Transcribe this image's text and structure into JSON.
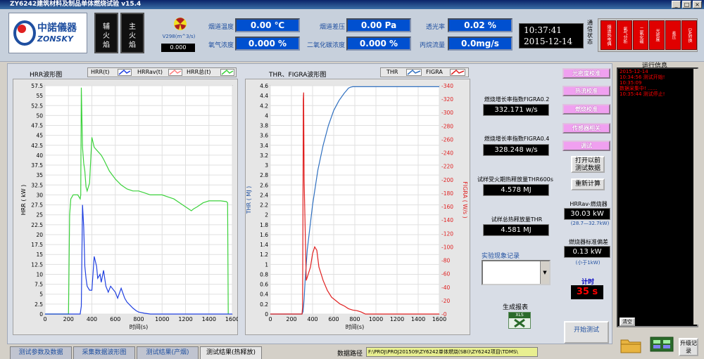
{
  "window": {
    "title": "ZY6242建筑材料及制品单体燃烧试验 v15.4"
  },
  "header": {
    "logo_brand": "中諾儀器",
    "logo_sub": "ZONSKY",
    "flame_aux": "辅火焰",
    "flame_main": "主火焰",
    "v298_label": "V298(m^3/s)",
    "v298_value": "0.000",
    "m1_label": "烟道温度",
    "m1_value": "0.00 ℃",
    "m2_label": "氧气浓度",
    "m2_value": "0.000 %",
    "m3_label": "烟道差压",
    "m3_value": "0.00 Pa",
    "m4_label": "二氧化碳浓度",
    "m4_value": "0.000 %",
    "m5_label": "透光率",
    "m5_value": "0.02 %",
    "m6_label": "丙烷流量",
    "m6_value": "0.0mg/s",
    "time": "10:37:41",
    "date": "2015-12-14",
    "comm_label": "通信状态",
    "leds": [
      "烟道热电偶",
      "氧气分析",
      "二氧化碳",
      "光密度",
      "差压",
      "DA转换"
    ]
  },
  "chart_hrr": {
    "title": "HRR波形图",
    "legend": [
      "HRR(t)",
      "HRRav(t)",
      "HRR总(t)"
    ],
    "ylabel": "HRR ( kW )",
    "xlabel": "时间(s)",
    "yticks": [
      "0",
      "2.5",
      "5",
      "7.5",
      "10",
      "12.5",
      "15",
      "17.5",
      "20",
      "22.5",
      "25",
      "27.5",
      "30",
      "32.5",
      "35",
      "37.5",
      "40",
      "42.5",
      "45",
      "47.5",
      "50",
      "52.5",
      "55",
      "57.5"
    ],
    "xticks": [
      "0",
      "200",
      "400",
      "600",
      "800",
      "1000",
      "1200",
      "1400",
      "1600"
    ]
  },
  "chart_thr": {
    "title": "THR、FIGRA波形图",
    "legend": [
      "THR",
      "FIGRA"
    ],
    "ylabel_left": "THR ( MJ )",
    "ylabel_right": "FIGRA ( W/s )",
    "xlabel": "时间(s)",
    "yticks_left": [
      "0",
      "0.2",
      "0.4",
      "0.6",
      "0.8",
      "1",
      "1.2",
      "1.4",
      "1.6",
      "1.8",
      "2",
      "2.2",
      "2.4",
      "2.6",
      "2.8",
      "3",
      "3.2",
      "3.4",
      "3.6",
      "3.8",
      "4",
      "4.2",
      "4.4",
      "4.6"
    ],
    "yticks_right": [
      "0",
      "20",
      "40",
      "60",
      "80",
      "100",
      "120",
      "140",
      "160",
      "180",
      "200",
      "220",
      "240",
      "260",
      "280",
      "300",
      "320",
      "340"
    ],
    "xticks": [
      "0",
      "200",
      "400",
      "600",
      "800",
      "1000",
      "1200",
      "1400",
      "1600"
    ]
  },
  "chart_data": [
    {
      "type": "line",
      "title": "HRR波形图",
      "xlabel": "时间(s)",
      "ylabel": "HRR ( kW )",
      "xlim": [
        0,
        1600
      ],
      "ylim": [
        0,
        57.5
      ],
      "series": [
        {
          "name": "HRR总(t)",
          "color": "#3cd23c",
          "x": [
            0,
            200,
            210,
            220,
            240,
            260,
            280,
            300,
            305,
            310,
            320,
            330,
            340,
            350,
            360,
            380,
            400,
            420,
            450,
            480,
            500,
            550,
            600,
            650,
            700,
            750,
            800,
            850,
            900,
            950,
            1000,
            1050,
            1100,
            1150,
            1200,
            1250,
            1270,
            1300,
            1350,
            1400,
            1450,
            1500,
            1550,
            1560,
            1565
          ],
          "y": [
            0,
            0,
            25,
            29,
            30,
            30,
            30,
            29,
            30,
            57,
            42,
            38,
            36,
            32,
            31,
            33,
            44.5,
            42,
            41,
            40,
            39,
            36,
            34,
            32.5,
            31.5,
            31,
            31,
            30.5,
            30,
            30,
            30,
            29.5,
            29,
            28,
            27,
            26,
            26.5,
            27,
            28,
            28.5,
            28.5,
            28.5,
            28.3,
            28,
            0
          ]
        },
        {
          "name": "HRR(t)",
          "color": "#2040e0",
          "x": [
            0,
            300,
            310,
            320,
            330,
            340,
            350,
            360,
            380,
            400,
            420,
            440,
            450,
            470,
            480,
            500,
            520,
            540,
            560,
            600,
            620,
            650,
            680,
            700,
            750,
            780,
            800,
            850,
            900,
            950,
            1000,
            1050,
            1600
          ],
          "y": [
            0,
            0,
            2,
            27.5,
            22,
            12,
            9,
            7,
            6,
            6,
            14.5,
            12,
            9,
            10,
            8,
            11,
            7,
            5.5,
            7,
            5.5,
            4,
            6.5,
            4,
            3,
            1.5,
            0.8,
            0.5,
            0.2,
            0,
            0,
            0,
            0,
            0
          ]
        }
      ]
    },
    {
      "type": "line",
      "title": "THR、FIGRA波形图",
      "xlabel": "时间(s)",
      "ylabel": "THR ( MJ )",
      "y2label": "FIGRA ( W/s )",
      "xlim": [
        0,
        1600
      ],
      "ylim": [
        0,
        4.6
      ],
      "y2lim": [
        0,
        340
      ],
      "series": [
        {
          "name": "THR",
          "color": "#3070c0",
          "axis": "left",
          "x": [
            0,
            300,
            310,
            320,
            330,
            350,
            400,
            450,
            500,
            550,
            600,
            650,
            700,
            720,
            740,
            760,
            780,
            800,
            820,
            1000,
            1600
          ],
          "y": [
            0,
            0,
            0.05,
            0.3,
            0.7,
            1.3,
            2.2,
            2.9,
            3.4,
            3.8,
            4.1,
            4.3,
            4.45,
            4.5,
            4.55,
            4.57,
            4.58,
            4.58,
            4.58,
            4.58,
            4.58
          ]
        },
        {
          "name": "FIGRA",
          "color": "#e02020",
          "axis": "right",
          "x": [
            0,
            300,
            305,
            310,
            312,
            315,
            320,
            340,
            380,
            400,
            420,
            440,
            460,
            480,
            500,
            540,
            580,
            620,
            660,
            700,
            740,
            780,
            820,
            860,
            900,
            1600
          ],
          "y": [
            0,
            0,
            10,
            200,
            320,
            330,
            200,
            50,
            70,
            90,
            100,
            95,
            70,
            60,
            50,
            35,
            25,
            20,
            15,
            12,
            8,
            6,
            5,
            3,
            0,
            0
          ]
        }
      ]
    }
  ],
  "results": {
    "figra02_label": "燃烧增长率指数FIGRA0.2",
    "figra02_value": "332.171 w/s",
    "figra04_label": "燃烧增长率指数FIGRA0.4",
    "figra04_value": "328.248 w/s",
    "thr600_label": "试样受火期热释放量THR600s",
    "thr600_value": "4.578 MJ",
    "thr_label": "试样总热释放量THR",
    "thr_value": "4.581 MJ",
    "phenomena_label": "实验现象记录",
    "report_label": "生成报表",
    "xls_label": "XLS"
  },
  "side": {
    "btn1": "光密度校准",
    "btn2": "热流校准",
    "btn3": "燃烧校准",
    "btn4": "传感器相关",
    "btn5": "调试",
    "open_prev": "打开以前测试数据",
    "recalc": "重新计算",
    "hrrav_label": "HRRav-燃烧器",
    "hrrav_value": "30.03 kW",
    "hrrav_range": "(28.7—32.7kW)",
    "std_label": "燃烧器标准偏差",
    "std_value": "0.13 kW",
    "std_range": "(小于1kW)",
    "timer_label": "计时",
    "timer_value": "35 s",
    "start_test": "开始测试"
  },
  "log": {
    "title": "运行信息",
    "lines": [
      "2015-12-14",
      "10:34:56 测试开始!",
      "10:35:09",
      "数据采集中! ......",
      "10:35:44 测试停止!"
    ],
    "clear": "清空"
  },
  "bottom": {
    "tabs": [
      "测试参数及数据",
      "采集数据波形图",
      "测试结果(产烟)",
      "测试结果(热释放)"
    ],
    "path_label": "数据路径",
    "path_value": "F:\\PROJ\\PROJ201509\\ZY6242单体燃烧(SBI)\\ZY6242项目\\TDMS\\",
    "upgrade": "升级记录"
  }
}
